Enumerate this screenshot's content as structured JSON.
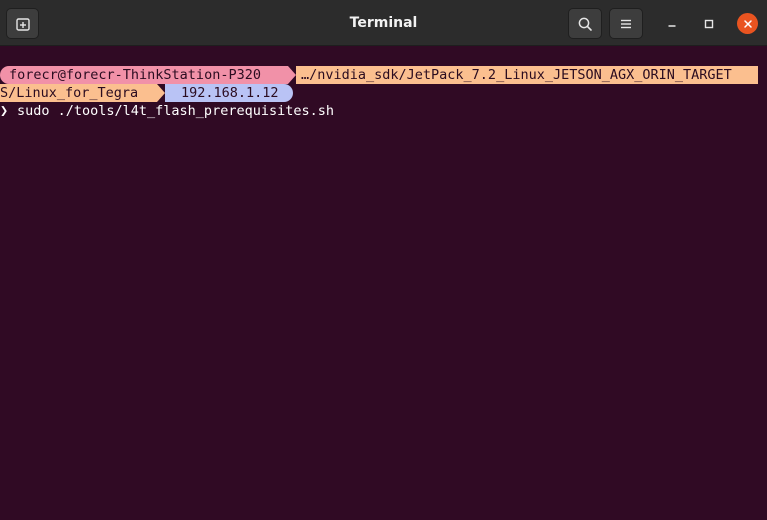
{
  "window": {
    "title": "Terminal"
  },
  "icons": {
    "new_tab": "new-tab-icon",
    "search": "search-icon",
    "menu": "hamburger-menu-icon",
    "minimize": "minimize-icon",
    "maximize": "maximize-icon",
    "close": "close-icon"
  },
  "prompt": {
    "user_host": "forecr@forecr-ThinkStation-P320",
    "path_line1": "…/nvidia_sdk/JetPack_7.2_Linux_JETSON_AGX_ORIN_TARGET",
    "path_line2": "S/Linux_for_Tegra",
    "ip": "192.168.1.12",
    "symbol": "❯",
    "command": "sudo ./tools/l4t_flash_prerequisites.sh"
  },
  "colors": {
    "background": "#300a24",
    "titlebar": "#2c2c2c",
    "user_segment": "#f191a8",
    "path_segment": "#fbbf8f",
    "ip_segment": "#b9c3f5",
    "close_button": "#e95420"
  }
}
